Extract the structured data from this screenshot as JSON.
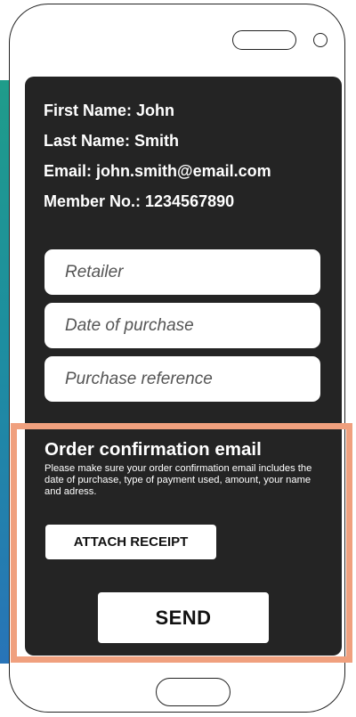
{
  "user": {
    "first_name_line": "First Name: John",
    "last_name_line": "Last Name: Smith",
    "email_line": "Email: john.smith@email.com",
    "member_line": "Member No.: 1234567890"
  },
  "form": {
    "retailer": {
      "value": "",
      "placeholder": "Retailer"
    },
    "date_of_purchase": {
      "value": "",
      "placeholder": "Date of purchase"
    },
    "purchase_reference": {
      "value": "",
      "placeholder": "Purchase reference"
    }
  },
  "order_section": {
    "title": "Order confirmation email",
    "description": "Please make sure your order confirmation email includes the date of purchase, type of payment used, amount, your name and adress.",
    "attach_label": "ATTACH RECEIPT"
  },
  "send_label": "SEND",
  "colors": {
    "screen_bg": "#242424",
    "highlight": "#f0a07e",
    "strip_top": "#1f9c8a",
    "strip_bottom": "#2874b8"
  }
}
